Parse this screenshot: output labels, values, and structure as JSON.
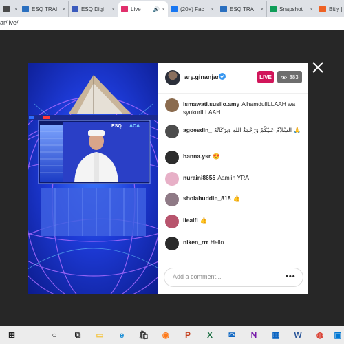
{
  "browser": {
    "tabs": [
      {
        "title": "",
        "color": "#4a4a4a"
      },
      {
        "title": "ESQ TRAI",
        "color": "#2a6fbf"
      },
      {
        "title": "ESQ Digi",
        "color": "#3b5bbd"
      },
      {
        "title": "Live",
        "color": "#e1306c",
        "active": true
      },
      {
        "title": "(20+) Fac",
        "color": "#1877f2"
      },
      {
        "title": "ESQ TRA",
        "color": "#2a6fbf"
      },
      {
        "title": "Snapshot",
        "color": "#0f9d58"
      },
      {
        "title": "Bitly | Lin",
        "color": "#ee6123"
      }
    ],
    "url": "ar/live/"
  },
  "live": {
    "username": "ary.ginanjar",
    "badge": "LIVE",
    "viewer_count": "383",
    "comments": [
      {
        "user": "ismawati.susilo.amy",
        "text": "AlhamdulILLAAH wa syukurILLAAH",
        "avatar_color": "#8b6b4e"
      },
      {
        "user": "agoesdin_",
        "text": "السَّلاَمُ عَلَيْكُمْ وَرَحْمَةُ اللهِ وَبَرَكَاتُهُ 🙏",
        "avatar_color": "#4d4d4d"
      },
      {
        "user": "hanna.ysr",
        "text": "😍",
        "avatar_color": "#2d2d2d"
      },
      {
        "user": "nuraini8655",
        "text": "Aamiin YRA",
        "avatar_color": "#e7b0c7"
      },
      {
        "user": "sholahuddin_818",
        "text": "👍",
        "avatar_color": "#8f7a86"
      },
      {
        "user": "iiealfi",
        "text": "👍",
        "avatar_color": "#b8546d"
      },
      {
        "user": "niken_rrr",
        "text": "Hello",
        "avatar_color": "#2b2b2b"
      }
    ],
    "comment_placeholder": "Add a comment...",
    "more_label": "•••"
  },
  "stream": {
    "screen_logo_1": "ESQ",
    "screen_logo_2": "ACA"
  },
  "taskbar": {
    "items": [
      "start-icon",
      "search-icon",
      "task-view-icon",
      "file-explorer-icon",
      "edge-icon",
      "store-icon",
      "firefox-icon",
      "powerpoint-icon",
      "excel-icon",
      "mail-icon",
      "onenote-icon",
      "calendar-icon",
      "word-icon",
      "chrome-icon",
      "photos-icon"
    ]
  }
}
